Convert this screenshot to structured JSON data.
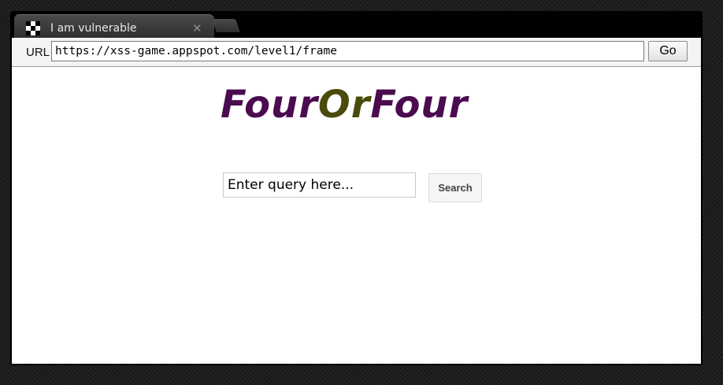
{
  "browser": {
    "tab": {
      "title": "I am vulnerable",
      "close_glyph": "✕",
      "favicon": "checkered-favicon-icon"
    },
    "new_tab_icon": "new-tab-icon",
    "url_label": "URL",
    "url_value": "https://xss-game.appspot.com/level1/frame",
    "go_label": "Go"
  },
  "page": {
    "logo": {
      "part1": "Four",
      "part2": "Or",
      "part3": "Four",
      "colors": {
        "four": "#4b0b4f",
        "or": "#4a4a0c"
      }
    },
    "search": {
      "placeholder": "Enter query here...",
      "button_label": "Search"
    }
  }
}
